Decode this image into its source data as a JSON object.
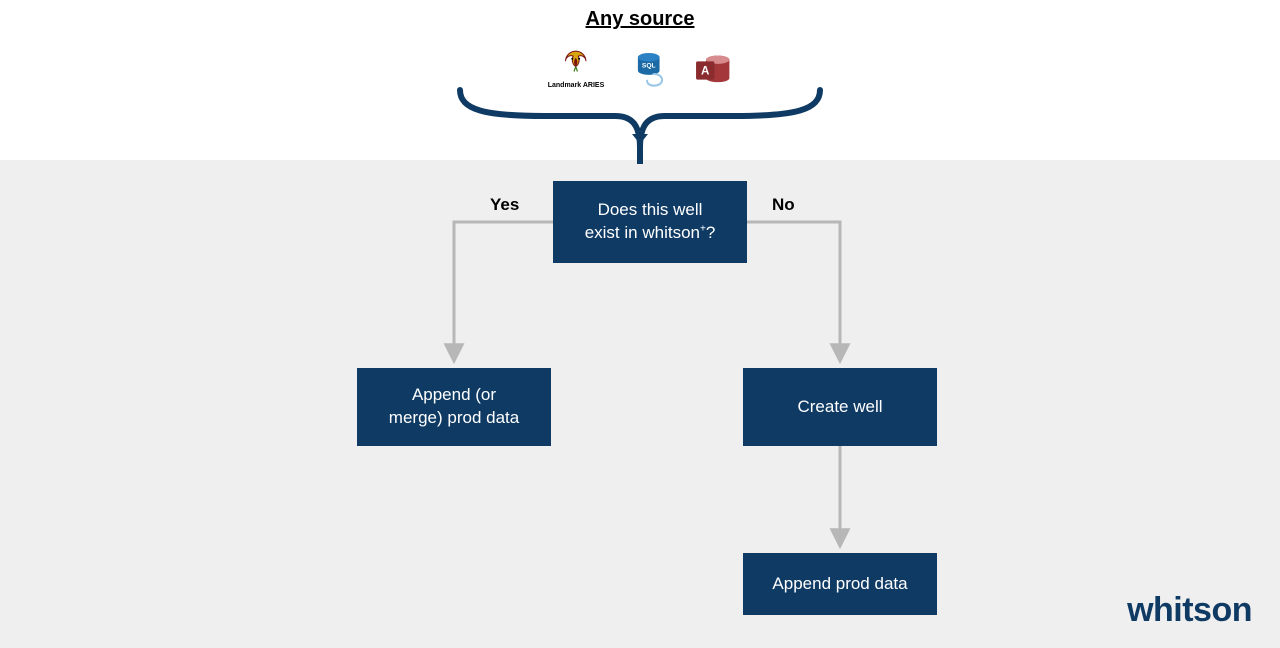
{
  "title": "Any source",
  "sources": {
    "aries_label": "Landmark ARIES",
    "sql_name": "sql-db-icon",
    "access_name": "ms-access-icon"
  },
  "decision": {
    "line1": "Does this well",
    "line2_pre": "exist in whitson",
    "line2_post": "?"
  },
  "labels": {
    "yes": "Yes",
    "no": "No"
  },
  "nodes": {
    "append_merge_l1": "Append (or",
    "append_merge_l2": "merge) prod data",
    "create_well": "Create well",
    "append_prod": "Append prod data"
  },
  "brand": "whitson",
  "colors": {
    "navy": "#0f3a64",
    "arrow": "#b7b7b7",
    "sql_blue": "#1b6aa5",
    "access_red": "#a4373a"
  }
}
